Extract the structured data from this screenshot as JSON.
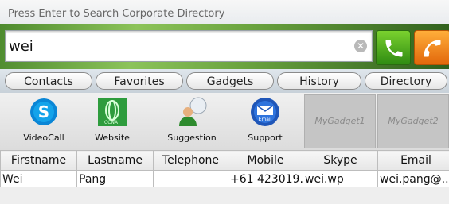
{
  "search": {
    "hint": "Press Enter to Search Corporate Directory",
    "value": "wei",
    "clear_icon": "clear-icon"
  },
  "call_buttons": {
    "green_icon": "phone-call-icon",
    "orange_icon": "phone-hangup-icon",
    "green_color": "#3fae19",
    "orange_color": "#f08a1c"
  },
  "tabs": [
    {
      "label": "Contacts"
    },
    {
      "label": "Favorites"
    },
    {
      "label": "Gadgets"
    },
    {
      "label": "History"
    },
    {
      "label": "Directory"
    }
  ],
  "gadgets": [
    {
      "label": "VideoCall",
      "icon": "skype-icon"
    },
    {
      "label": "Website",
      "icon": "website-icon"
    },
    {
      "label": "Suggestion",
      "icon": "suggestion-icon"
    },
    {
      "label": "Support",
      "icon": "email-icon"
    },
    {
      "label": "MyGadget1"
    },
    {
      "label": "MyGadget2"
    }
  ],
  "table": {
    "headers": [
      "Firstname",
      "Lastname",
      "Telephone",
      "Mobile",
      "Skype",
      "Email"
    ],
    "rows": [
      [
        "Wei",
        "Pang",
        "",
        "+61 423019...",
        "wei.wp",
        "wei.pang@..."
      ]
    ]
  }
}
